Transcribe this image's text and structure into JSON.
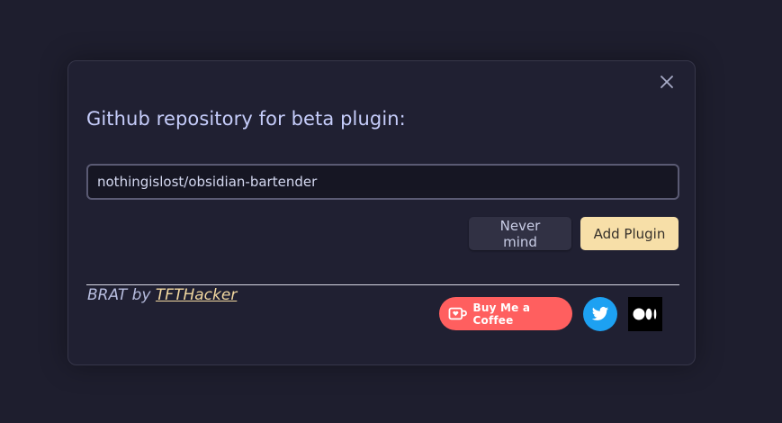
{
  "modal": {
    "title": "Github repository for beta plugin:",
    "close_icon": "close-icon"
  },
  "repo_input": {
    "value": "nothingislost/obsidian-bartender",
    "placeholder": ""
  },
  "buttons": {
    "cancel_label": "Never mind",
    "add_label": "Add Plugin"
  },
  "footer": {
    "credit_prefix": "BRAT by ",
    "credit_link": "TFTHacker",
    "coffee_label": "Buy Me a Coffee",
    "twitter_icon": "twitter-icon",
    "medium_icon": "medium-icon"
  },
  "colors": {
    "accent": "#f7dfa8",
    "coffee": "#ff5f5f",
    "twitter": "#1da1f2",
    "title": "#c6cdfb"
  }
}
